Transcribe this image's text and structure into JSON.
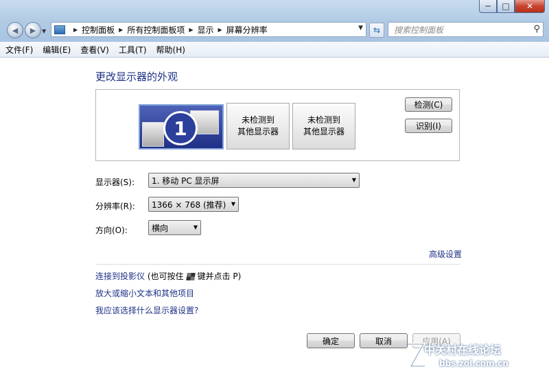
{
  "window": {
    "caption_buttons": {
      "minimize": "─",
      "maximize": "□",
      "close": "✕"
    }
  },
  "address_bar": {
    "breadcrumbs": [
      "控制面板",
      "所有控制面板项",
      "显示",
      "屏幕分辨率"
    ],
    "search_placeholder": "搜索控制面板"
  },
  "menu": [
    "文件(F)",
    "编辑(E)",
    "查看(V)",
    "工具(T)",
    "帮助(H)"
  ],
  "content": {
    "title": "更改显示器的外观",
    "monitor_1_number": "1",
    "monitor_2_label_line1": "未检测到",
    "monitor_2_label_line2": "其他显示器",
    "monitor_3_label_line1": "未检测到",
    "monitor_3_label_line2": "其他显示器",
    "detect_button": "检测(C)",
    "identify_button": "识别(I)",
    "display_label": "显示器(S):",
    "display_value": "1. 移动 PC 显示屏",
    "resolution_label": "分辨率(R):",
    "resolution_value": "1366 × 768 (推荐)",
    "orientation_label": "方向(O):",
    "orientation_value": "横向",
    "advanced_link": "高级设置",
    "projector_link_a": "连接到投影仪",
    "projector_link_b": "(也可按住",
    "projector_link_c": "键并点击 P)",
    "text_size_link": "放大或缩小文本和其他项目",
    "which_settings_link": "我应该选择什么显示器设置?",
    "ok_button": "确定",
    "cancel_button": "取消",
    "apply_button": "应用(A)"
  },
  "watermark": {
    "line1": "中关村在线论坛",
    "line2": "bbs.zol.com.cn"
  }
}
